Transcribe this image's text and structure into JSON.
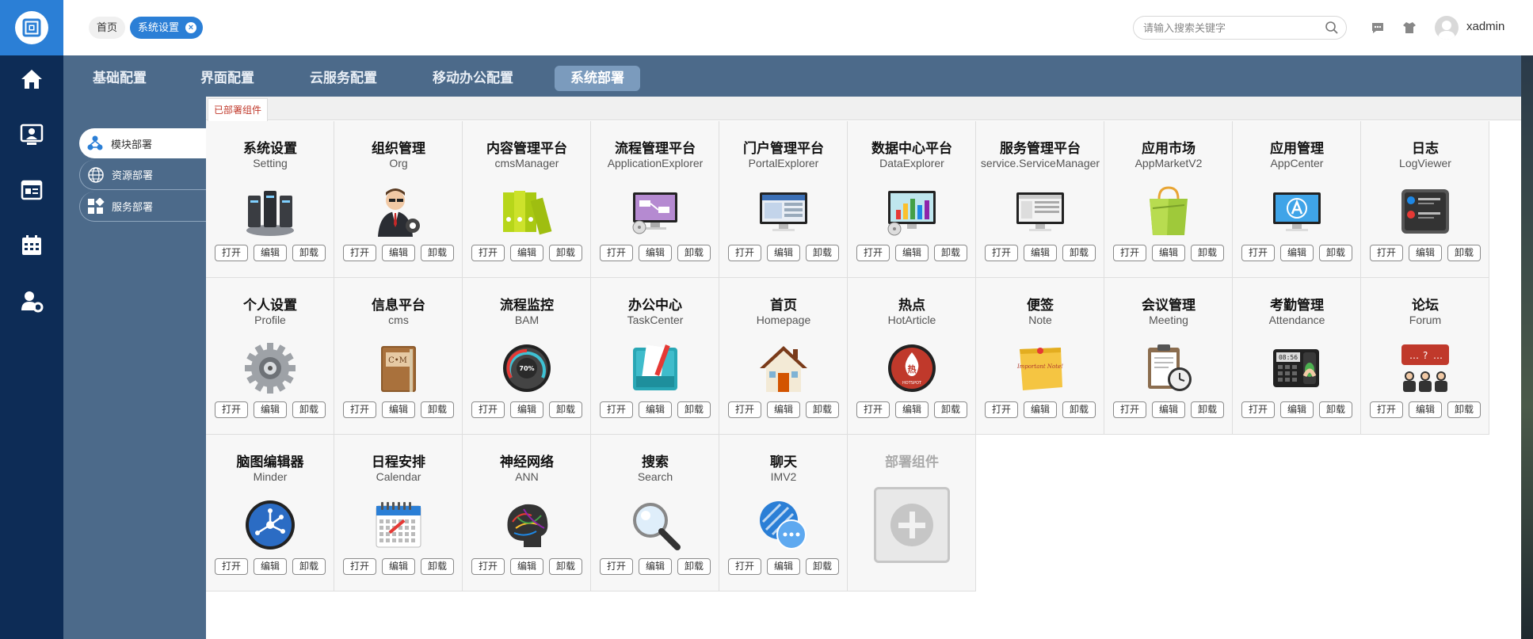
{
  "topbar": {
    "breadcrumb_home": "首页",
    "breadcrumb_active": "系统设置",
    "search_placeholder": "请输入搜索关键字",
    "username": "xadmin"
  },
  "tabs": [
    {
      "label": "基础配置",
      "active": false
    },
    {
      "label": "界面配置",
      "active": false
    },
    {
      "label": "云服务配置",
      "active": false
    },
    {
      "label": "移动办公配置",
      "active": false
    },
    {
      "label": "系统部署",
      "active": true
    }
  ],
  "sidebar": {
    "items": [
      {
        "label": "模块部署",
        "icon": "module-icon",
        "active": true
      },
      {
        "label": "资源部署",
        "icon": "globe-icon",
        "active": false
      },
      {
        "label": "服务部署",
        "icon": "grid-icon",
        "active": false
      }
    ]
  },
  "content_tab": "已部署组件",
  "button_labels": {
    "open": "打开",
    "edit": "编辑",
    "uninstall": "卸载"
  },
  "modules": [
    {
      "title": "系统设置",
      "sub": "Setting",
      "icon": "server-icon"
    },
    {
      "title": "组织管理",
      "sub": "Org",
      "icon": "manager-icon"
    },
    {
      "title": "内容管理平台",
      "sub": "cmsManager",
      "icon": "binders-icon"
    },
    {
      "title": "流程管理平台",
      "sub": "ApplicationExplorer",
      "icon": "monitor-flow-icon"
    },
    {
      "title": "门户管理平台",
      "sub": "PortalExplorer",
      "icon": "monitor-portal-icon"
    },
    {
      "title": "数据中心平台",
      "sub": "DataExplorer",
      "icon": "monitor-chart-icon"
    },
    {
      "title": "服务管理平台",
      "sub": "service.ServiceManager",
      "icon": "monitor-service-icon"
    },
    {
      "title": "应用市场",
      "sub": "AppMarketV2",
      "icon": "shopping-bag-icon"
    },
    {
      "title": "应用管理",
      "sub": "AppCenter",
      "icon": "monitor-appstore-icon"
    },
    {
      "title": "日志",
      "sub": "LogViewer",
      "icon": "log-viewer-icon"
    },
    {
      "title": "个人设置",
      "sub": "Profile",
      "icon": "gear-icon"
    },
    {
      "title": "信息平台",
      "sub": "cms",
      "icon": "notebook-icon"
    },
    {
      "title": "流程监控",
      "sub": "BAM",
      "icon": "gauge-icon",
      "gauge_value": "70%"
    },
    {
      "title": "办公中心",
      "sub": "TaskCenter",
      "icon": "folder-pencil-icon"
    },
    {
      "title": "首页",
      "sub": "Homepage",
      "icon": "house-icon"
    },
    {
      "title": "热点",
      "sub": "HotArticle",
      "icon": "hotspot-icon",
      "badge": "热",
      "badge_sub": "HOTSPOT"
    },
    {
      "title": "便签",
      "sub": "Note",
      "icon": "sticky-note-icon",
      "note_text": "Important Note!"
    },
    {
      "title": "会议管理",
      "sub": "Meeting",
      "icon": "clipboard-clock-icon"
    },
    {
      "title": "考勤管理",
      "sub": "Attendance",
      "icon": "fingerprint-clock-icon",
      "clock_text": "08:56"
    },
    {
      "title": "论坛",
      "sub": "Forum",
      "icon": "forum-people-icon"
    },
    {
      "title": "脑图编辑器",
      "sub": "Minder",
      "icon": "mindmap-icon"
    },
    {
      "title": "日程安排",
      "sub": "Calendar",
      "icon": "calendar-icon"
    },
    {
      "title": "神经网络",
      "sub": "ANN",
      "icon": "brain-icon"
    },
    {
      "title": "搜索",
      "sub": "Search",
      "icon": "magnifier-icon"
    },
    {
      "title": "聊天",
      "sub": "IMV2",
      "icon": "chat-bubble-icon"
    }
  ],
  "add_card": {
    "title": "部署组件"
  }
}
